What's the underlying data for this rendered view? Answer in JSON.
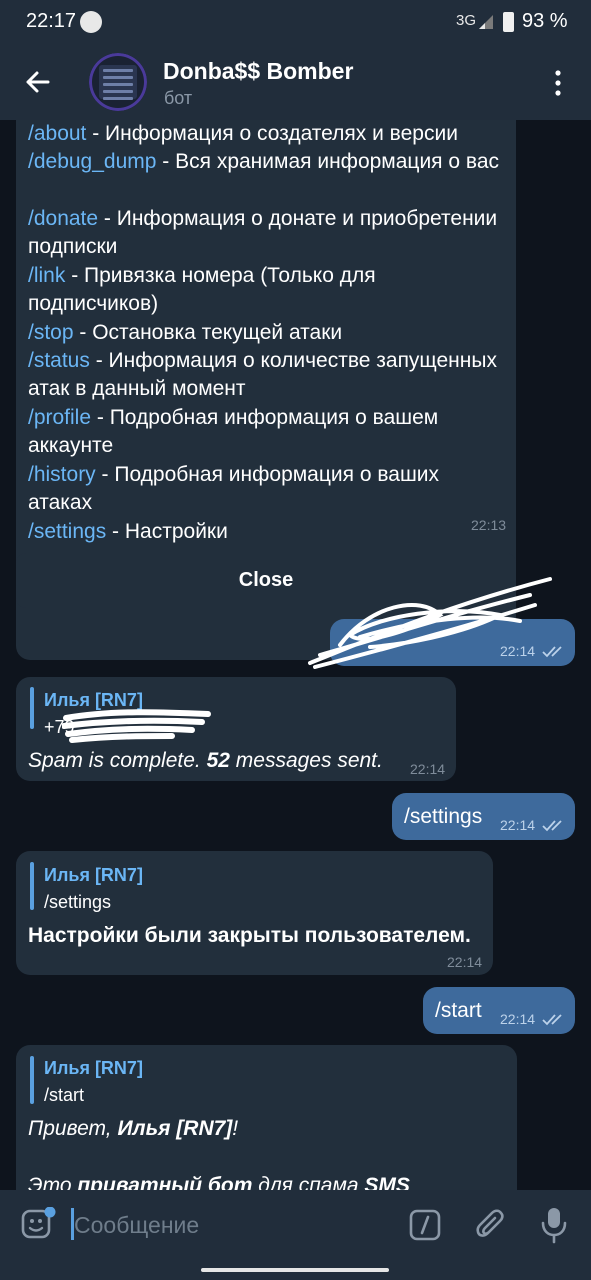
{
  "status_bar": {
    "time": "22:17",
    "network": "3G",
    "battery": "93 %"
  },
  "header": {
    "title": "Donba$$ Bomber",
    "subtitle": "бот"
  },
  "command_list": {
    "items": [
      {
        "cmd": "/about",
        "desc": " - Информация о создателях и версии"
      },
      {
        "cmd": "/debug_dump",
        "desc": " - Вся хранимая информация о вас"
      },
      {
        "cmd": "/donate",
        "desc": " - Информация о донате и приобретении подписки"
      },
      {
        "cmd": "/link",
        "desc": " - Привязка номера (Только для подписчиков)"
      },
      {
        "cmd": "/stop",
        "desc": " - Остановка текущей атаки"
      },
      {
        "cmd": "/status",
        "desc": " - Информация о количестве запущенных атак в данный момент"
      },
      {
        "cmd": "/profile",
        "desc": " - Подробная информация о вашем аккаунте"
      },
      {
        "cmd": "/history",
        "desc": " - Подробная информация о ваших атаках"
      },
      {
        "cmd": "/settings",
        "desc": " - Настройки"
      }
    ],
    "time": "22:13"
  },
  "close_button": {
    "label": "Close"
  },
  "messages": {
    "out1": {
      "time": "22:14"
    },
    "in1": {
      "quote_name": "Илья [RN7]",
      "quote_text": "+79",
      "text_a": "Spam is complete. ",
      "text_b": "52",
      "text_c": " messages sent.",
      "time": "22:14"
    },
    "out2": {
      "text": "/settings",
      "time": "22:14"
    },
    "in2": {
      "quote_name": "Илья [RN7]",
      "quote_text": "/settings",
      "text": "Настройки были закрыты пользователем.",
      "time": "22:14"
    },
    "out3": {
      "text": "/start",
      "time": "22:14"
    },
    "in3": {
      "quote_name": "Илья [RN7]",
      "quote_text": "/start",
      "line1_a": "Привет, ",
      "line1_b": "Илья [RN7]",
      "line1_c": "!",
      "line2_a": "Это ",
      "line2_b": "приватный бот",
      "line2_c": " для спама ",
      "line2_d": "SMS"
    }
  },
  "input": {
    "placeholder": "Сообщение"
  },
  "colors": {
    "accent": "#6bb6f5",
    "outgoing_bubble": "#3e6a9c",
    "incoming_bubble": "#222f3c",
    "background": "#0e141d",
    "header": "#212d3b"
  }
}
